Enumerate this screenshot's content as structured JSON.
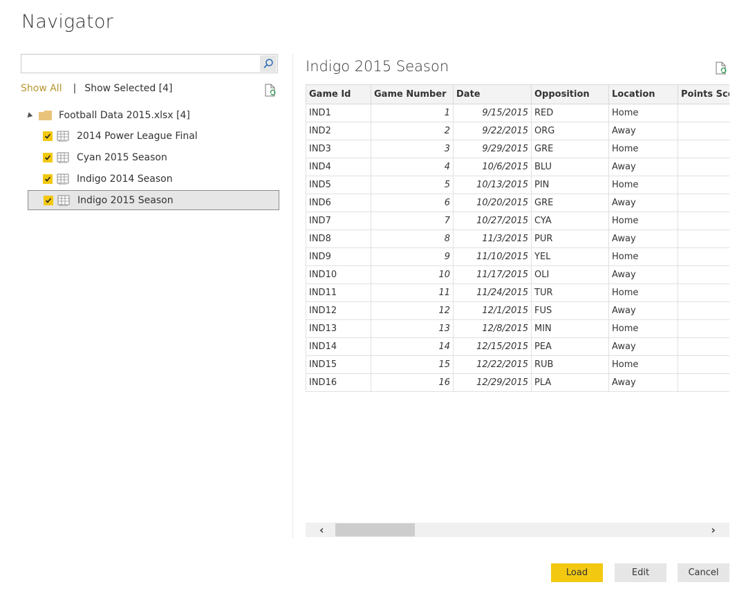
{
  "window": {
    "title": "Navigator"
  },
  "search": {
    "value": "",
    "placeholder": ""
  },
  "filters": {
    "show_all": "Show All",
    "separator": "|",
    "show_selected": "Show Selected [4]"
  },
  "tree": {
    "root": {
      "label": "Football Data 2015.xlsx [4]",
      "icon": "folder-icon",
      "expanded": true
    },
    "items": [
      {
        "label": "2014 Power League Final",
        "checked": true,
        "icon": "table-icon",
        "selected": false
      },
      {
        "label": "Cyan 2015 Season",
        "checked": true,
        "icon": "table-icon",
        "selected": false
      },
      {
        "label": "Indigo 2014 Season",
        "checked": true,
        "icon": "table-icon",
        "selected": false
      },
      {
        "label": "Indigo 2015 Season",
        "checked": true,
        "icon": "table-icon",
        "selected": true
      }
    ]
  },
  "preview": {
    "title": "Indigo 2015 Season",
    "columns": [
      "Game Id",
      "Game Number",
      "Date",
      "Opposition",
      "Location",
      "Points Scored"
    ],
    "rows": [
      [
        "IND1",
        "1",
        "9/15/2015",
        "RED",
        "Home",
        ""
      ],
      [
        "IND2",
        "2",
        "9/22/2015",
        "ORG",
        "Away",
        ""
      ],
      [
        "IND3",
        "3",
        "9/29/2015",
        "GRE",
        "Home",
        ""
      ],
      [
        "IND4",
        "4",
        "10/6/2015",
        "BLU",
        "Away",
        ""
      ],
      [
        "IND5",
        "5",
        "10/13/2015",
        "PIN",
        "Home",
        ""
      ],
      [
        "IND6",
        "6",
        "10/20/2015",
        "GRE",
        "Away",
        ""
      ],
      [
        "IND7",
        "7",
        "10/27/2015",
        "CYA",
        "Home",
        ""
      ],
      [
        "IND8",
        "8",
        "11/3/2015",
        "PUR",
        "Away",
        ""
      ],
      [
        "IND9",
        "9",
        "11/10/2015",
        "YEL",
        "Home",
        ""
      ],
      [
        "IND10",
        "10",
        "11/17/2015",
        "OLI",
        "Away",
        ""
      ],
      [
        "IND11",
        "11",
        "11/24/2015",
        "TUR",
        "Home",
        ""
      ],
      [
        "IND12",
        "12",
        "12/1/2015",
        "FUS",
        "Away",
        ""
      ],
      [
        "IND13",
        "13",
        "12/8/2015",
        "MIN",
        "Home",
        ""
      ],
      [
        "IND14",
        "14",
        "12/15/2015",
        "PEA",
        "Away",
        ""
      ],
      [
        "IND15",
        "15",
        "12/22/2015",
        "RUB",
        "Home",
        ""
      ],
      [
        "IND16",
        "16",
        "12/29/2015",
        "PLA",
        "Away",
        ""
      ]
    ]
  },
  "scrollbar": {
    "left_arrow": "‹",
    "right_arrow": "›"
  },
  "footer": {
    "load": "Load",
    "edit": "Edit",
    "cancel": "Cancel"
  },
  "colors": {
    "accent": "#f2c811",
    "show_all_link": "#b8962e",
    "selected_row_bg": "#e6e6e6"
  }
}
